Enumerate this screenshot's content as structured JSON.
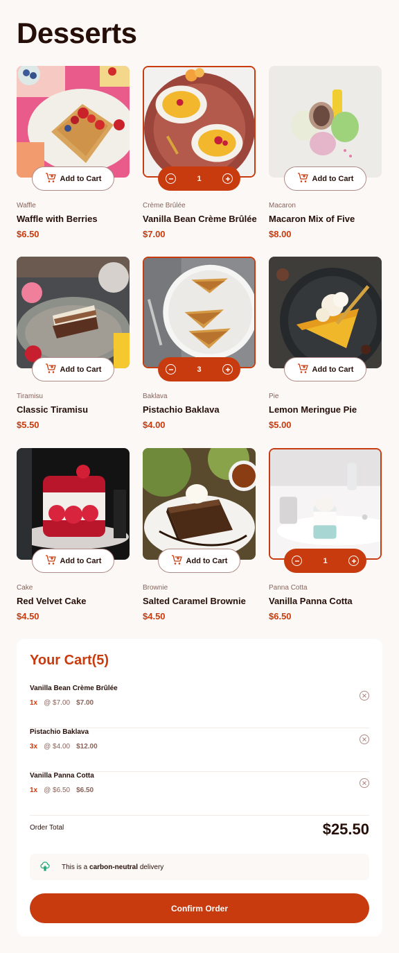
{
  "page": {
    "title": "Desserts"
  },
  "colors": {
    "accent": "#c73b0f",
    "text_dark": "#260f08",
    "text_muted": "#87635a",
    "background": "#fcf8f5"
  },
  "icons": {
    "add_to_cart": "cart-plus-icon",
    "decrement": "minus-circle-icon",
    "increment": "plus-circle-icon",
    "remove": "x-circle-icon",
    "carbon": "tree-icon"
  },
  "products": [
    {
      "category": "Waffle",
      "name": "Waffle with Berries",
      "price": "$6.50",
      "button_label": "Add to Cart",
      "in_cart": false,
      "quantity": ""
    },
    {
      "category": "Crème Brûlée",
      "name": "Vanilla Bean Crème Brûlée",
      "price": "$7.00",
      "button_label": "Add to Cart",
      "in_cart": true,
      "quantity": "1"
    },
    {
      "category": "Macaron",
      "name": "Macaron Mix of Five",
      "price": "$8.00",
      "button_label": "Add to Cart",
      "in_cart": false,
      "quantity": ""
    },
    {
      "category": "Tiramisu",
      "name": "Classic Tiramisu",
      "price": "$5.50",
      "button_label": "Add to Cart",
      "in_cart": false,
      "quantity": ""
    },
    {
      "category": "Baklava",
      "name": "Pistachio Baklava",
      "price": "$4.00",
      "button_label": "Add to Cart",
      "in_cart": true,
      "quantity": "3"
    },
    {
      "category": "Pie",
      "name": "Lemon Meringue Pie",
      "price": "$5.00",
      "button_label": "Add to Cart",
      "in_cart": false,
      "quantity": ""
    },
    {
      "category": "Cake",
      "name": "Red Velvet Cake",
      "price": "$4.50",
      "button_label": "Add to Cart",
      "in_cart": false,
      "quantity": ""
    },
    {
      "category": "Brownie",
      "name": "Salted Caramel Brownie",
      "price": "$4.50",
      "button_label": "Add to Cart",
      "in_cart": false,
      "quantity": ""
    },
    {
      "category": "Panna Cotta",
      "name": "Vanilla Panna Cotta",
      "price": "$6.50",
      "button_label": "Add to Cart",
      "in_cart": true,
      "quantity": "1"
    }
  ],
  "cart": {
    "title": "Your Cart(5)",
    "items": [
      {
        "name": "Vanilla Bean Crème Brûlée",
        "qty": "1x",
        "unit": "@ $7.00",
        "total": "$7.00"
      },
      {
        "name": "Pistachio Baklava",
        "qty": "3x",
        "unit": "@ $4.00",
        "total": "$12.00"
      },
      {
        "name": "Vanilla Panna Cotta",
        "qty": "1x",
        "unit": "@ $6.50",
        "total": "$6.50"
      }
    ],
    "order_total_label": "Order Total",
    "order_total_value": "$25.50",
    "carbon_prefix": "This is a",
    "carbon_bold": "carbon-neutral",
    "carbon_suffix": "delivery",
    "confirm_label": "Confirm Order"
  }
}
